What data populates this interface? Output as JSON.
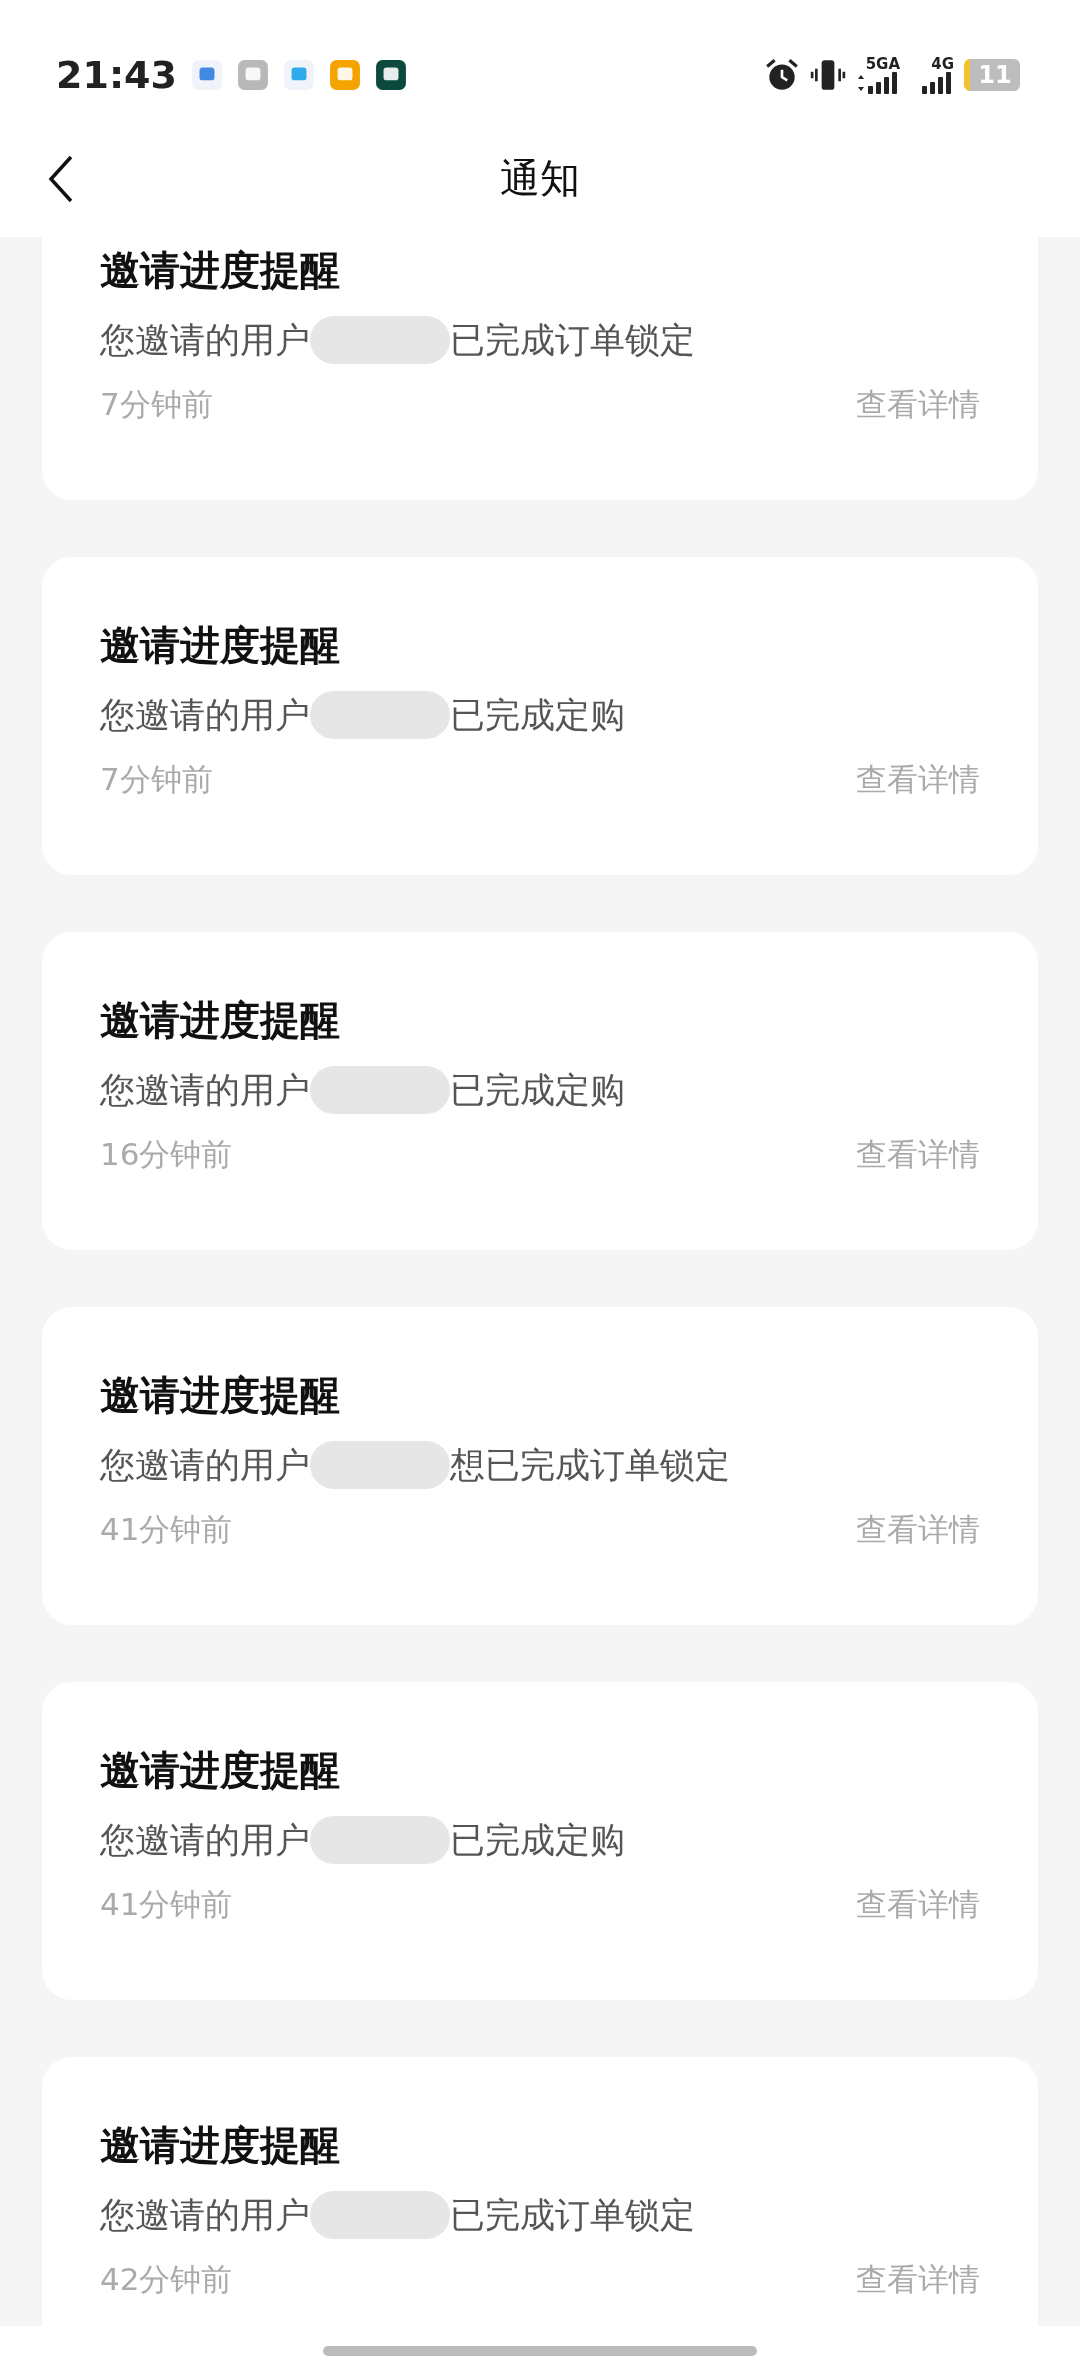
{
  "status_bar": {
    "time": "21:43",
    "networks": [
      {
        "label": "5GA",
        "kind": "dual"
      },
      {
        "label": "4G",
        "kind": "single"
      }
    ],
    "battery": "11"
  },
  "header": {
    "title": "通知"
  },
  "notifications": [
    {
      "title": "邀请进度提醒",
      "prefix": "您邀请的用户",
      "suffix": "已完成订单锁定",
      "time": "7分钟前",
      "action": "查看详情"
    },
    {
      "title": "邀请进度提醒",
      "prefix": "您邀请的用户",
      "suffix": "已完成定购",
      "time": "7分钟前",
      "action": "查看详情"
    },
    {
      "title": "邀请进度提醒",
      "prefix": "您邀请的用户",
      "suffix": "已完成定购",
      "time": "16分钟前",
      "action": "查看详情"
    },
    {
      "title": "邀请进度提醒",
      "prefix": "您邀请的用户",
      "suffix": "想已完成订单锁定",
      "time": "41分钟前",
      "action": "查看详情"
    },
    {
      "title": "邀请进度提醒",
      "prefix": "您邀请的用户",
      "suffix": "已完成定购",
      "time": "41分钟前",
      "action": "查看详情"
    },
    {
      "title": "邀请进度提醒",
      "prefix": "您邀请的用户",
      "suffix": "已完成订单锁定",
      "time": "42分钟前",
      "action": "查看详情"
    }
  ]
}
